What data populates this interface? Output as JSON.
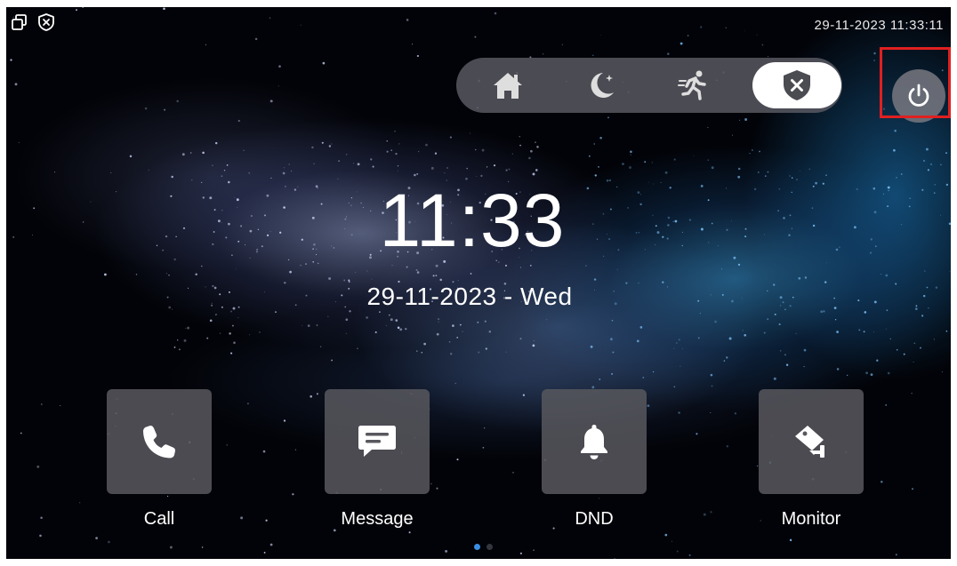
{
  "status_bar": {
    "datetime": "29-11-2023 11:33:11",
    "left_icons": [
      "window-restore-icon",
      "shield-x-icon"
    ]
  },
  "modes": {
    "items": [
      {
        "name": "home",
        "icon": "home-icon"
      },
      {
        "name": "night",
        "icon": "moon-icon"
      },
      {
        "name": "away",
        "icon": "running-person-icon"
      },
      {
        "name": "disarmed",
        "icon": "shield-x-icon",
        "active": true
      }
    ]
  },
  "power": {
    "icon": "power-icon"
  },
  "clock": {
    "time": "11:33",
    "date": "29-11-2023 - Wed"
  },
  "apps": [
    {
      "label": "Call",
      "icon": "phone-icon"
    },
    {
      "label": "Message",
      "icon": "message-icon"
    },
    {
      "label": "DND",
      "icon": "bell-icon"
    },
    {
      "label": "Monitor",
      "icon": "camera-icon"
    }
  ],
  "pager": {
    "pages": 2,
    "current": 1
  },
  "colors": {
    "accent_dot": "#3a8ee6",
    "highlight": "#e02020",
    "tile_bg": "#58585e"
  }
}
